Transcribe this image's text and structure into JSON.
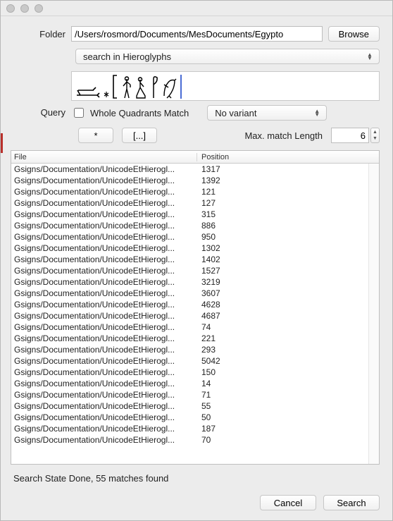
{
  "titlebar": {},
  "folder": {
    "label": "Folder",
    "path": "/Users/rosmord/Documents/MesDocuments/Egypto",
    "browse_label": "Browse"
  },
  "search_mode": {
    "selected": "search in Hieroglyphs"
  },
  "query": {
    "label": "Query",
    "whole_quadrants_label": "Whole Quadrants Match",
    "whole_quadrants_checked": false,
    "variant_selected": "No variant"
  },
  "toolbar": {
    "btn_star": "*",
    "btn_brackets": "[...]",
    "max_match_label": "Max. match Length",
    "max_match_value": "6"
  },
  "table": {
    "headers": {
      "file": "File",
      "position": "Position"
    },
    "rows": [
      {
        "file": "Gsigns/Documentation/UnicodeEtHierogl...",
        "pos": "1317"
      },
      {
        "file": "Gsigns/Documentation/UnicodeEtHierogl...",
        "pos": "1392"
      },
      {
        "file": "Gsigns/Documentation/UnicodeEtHierogl...",
        "pos": "121"
      },
      {
        "file": "Gsigns/Documentation/UnicodeEtHierogl...",
        "pos": "127"
      },
      {
        "file": "Gsigns/Documentation/UnicodeEtHierogl...",
        "pos": "315"
      },
      {
        "file": "Gsigns/Documentation/UnicodeEtHierogl...",
        "pos": "886"
      },
      {
        "file": "Gsigns/Documentation/UnicodeEtHierogl...",
        "pos": "950"
      },
      {
        "file": "Gsigns/Documentation/UnicodeEtHierogl...",
        "pos": "1302"
      },
      {
        "file": "Gsigns/Documentation/UnicodeEtHierogl...",
        "pos": "1402"
      },
      {
        "file": "Gsigns/Documentation/UnicodeEtHierogl...",
        "pos": "1527"
      },
      {
        "file": "Gsigns/Documentation/UnicodeEtHierogl...",
        "pos": "3219"
      },
      {
        "file": "Gsigns/Documentation/UnicodeEtHierogl...",
        "pos": "3607"
      },
      {
        "file": "Gsigns/Documentation/UnicodeEtHierogl...",
        "pos": "4628"
      },
      {
        "file": "Gsigns/Documentation/UnicodeEtHierogl...",
        "pos": "4687"
      },
      {
        "file": "Gsigns/Documentation/UnicodeEtHierogl...",
        "pos": "74"
      },
      {
        "file": "Gsigns/Documentation/UnicodeEtHierogl...",
        "pos": "221"
      },
      {
        "file": "Gsigns/Documentation/UnicodeEtHierogl...",
        "pos": "293"
      },
      {
        "file": "Gsigns/Documentation/UnicodeEtHierogl...",
        "pos": "5042"
      },
      {
        "file": "Gsigns/Documentation/UnicodeEtHierogl...",
        "pos": "150"
      },
      {
        "file": "Gsigns/Documentation/UnicodeEtHierogl...",
        "pos": "14"
      },
      {
        "file": "Gsigns/Documentation/UnicodeEtHierogl...",
        "pos": "71"
      },
      {
        "file": "Gsigns/Documentation/UnicodeEtHierogl...",
        "pos": "55"
      },
      {
        "file": "Gsigns/Documentation/UnicodeEtHierogl...",
        "pos": "50"
      },
      {
        "file": "Gsigns/Documentation/UnicodeEtHierogl...",
        "pos": "187"
      },
      {
        "file": "Gsigns/Documentation/UnicodeEtHierogl...",
        "pos": "70"
      }
    ]
  },
  "status_text": "Search State Done, 55 matches found",
  "footer": {
    "cancel_label": "Cancel",
    "search_label": "Search"
  }
}
